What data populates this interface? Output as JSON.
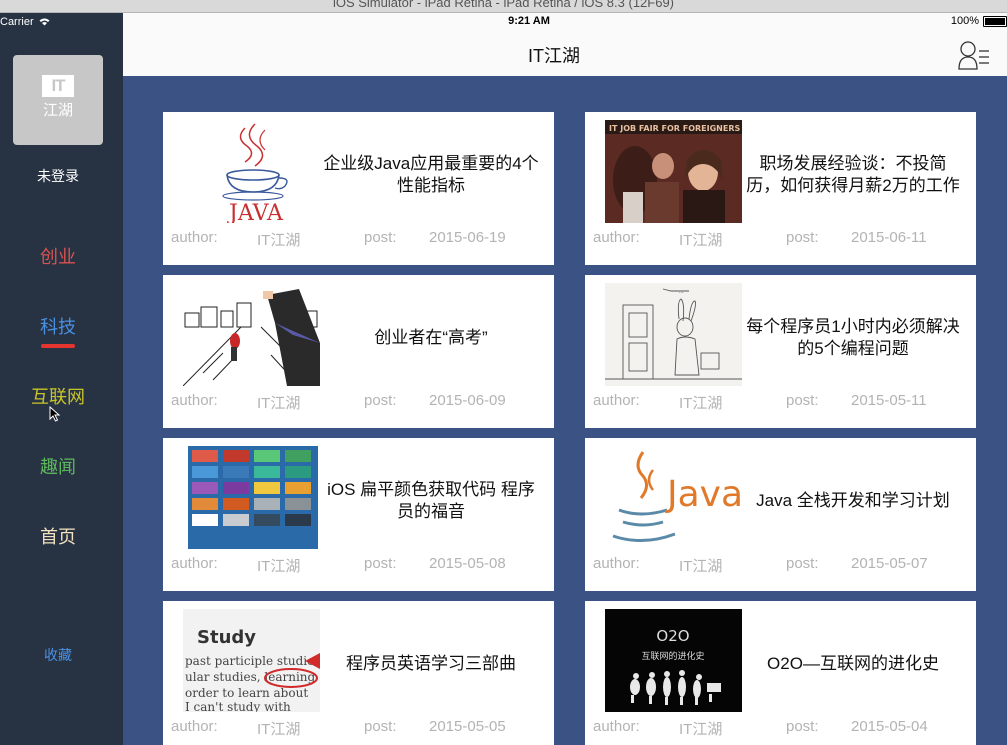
{
  "window": {
    "title": "iOS Simulator - iPad Retina - iPad Retina / iOS 8.3 (12F69)"
  },
  "status_bar": {
    "carrier": "Carrier",
    "time": "9:21 AM",
    "battery": "100%"
  },
  "sidebar": {
    "logo": {
      "line1": "IT",
      "line2": "江湖"
    },
    "login_label": "未登录",
    "nav": [
      {
        "label": "创业",
        "color": "#d9534f"
      },
      {
        "label": "科技",
        "color": "#4a90e2"
      },
      {
        "label": "互联网",
        "color": "#c8c42a"
      },
      {
        "label": "趣闻",
        "color": "#5cb85c"
      },
      {
        "label": "首页",
        "color": "#f2e2c0"
      }
    ],
    "favorites": "收藏",
    "active_underline_color": "#e4352f"
  },
  "header": {
    "title": "IT江湖",
    "user_icon": "user-menu-icon"
  },
  "articles": [
    {
      "title": "企业级Java应用最重要的4个性能指标",
      "author_label": "author:",
      "author": "IT江湖",
      "post_label": "post:",
      "date": "2015-06-19",
      "thumb": "java-logo"
    },
    {
      "title": "职场发展经验谈：不投简历，如何获得月薪2万的工作",
      "author_label": "author:",
      "author": "IT江湖",
      "post_label": "post:",
      "date": "2015-06-11",
      "thumb": "job-fair-photo",
      "thumb_text": "IT JOB FAIR FOR FOREIGNERS"
    },
    {
      "title": "创业者在“高考”",
      "author_label": "author:",
      "author": "IT江湖",
      "post_label": "post:",
      "date": "2015-06-09",
      "thumb": "road-sketch"
    },
    {
      "title": "每个程序员1小时内必须解决的5个编程问题",
      "author_label": "author:",
      "author": "IT江湖",
      "post_label": "post:",
      "date": "2015-05-11",
      "thumb": "rabbit-sketch"
    },
    {
      "title": "iOS 扁平颜色获取代码 程序员的福音",
      "author_label": "author:",
      "author": "IT江湖",
      "post_label": "post:",
      "date": "2015-05-08",
      "thumb": "color-swatches"
    },
    {
      "title": "Java 全栈开发和学习计划",
      "author_label": "author:",
      "author": "IT江湖",
      "post_label": "post:",
      "date": "2015-05-07",
      "thumb": "java-logo-orange",
      "thumb_text": "Java"
    },
    {
      "title": "程序员英语学习三部曲",
      "author_label": "author:",
      "author": "IT江湖",
      "post_label": "post:",
      "date": "2015-05-05",
      "thumb": "study-words",
      "thumb_text": "Study"
    },
    {
      "title": "O2O—互联网的进化史",
      "author_label": "author:",
      "author": "IT江湖",
      "post_label": "post:",
      "date": "2015-05-04",
      "thumb": "o2o-evolution",
      "thumb_text": "O2O",
      "thumb_sub": "互联网的进化史"
    }
  ]
}
